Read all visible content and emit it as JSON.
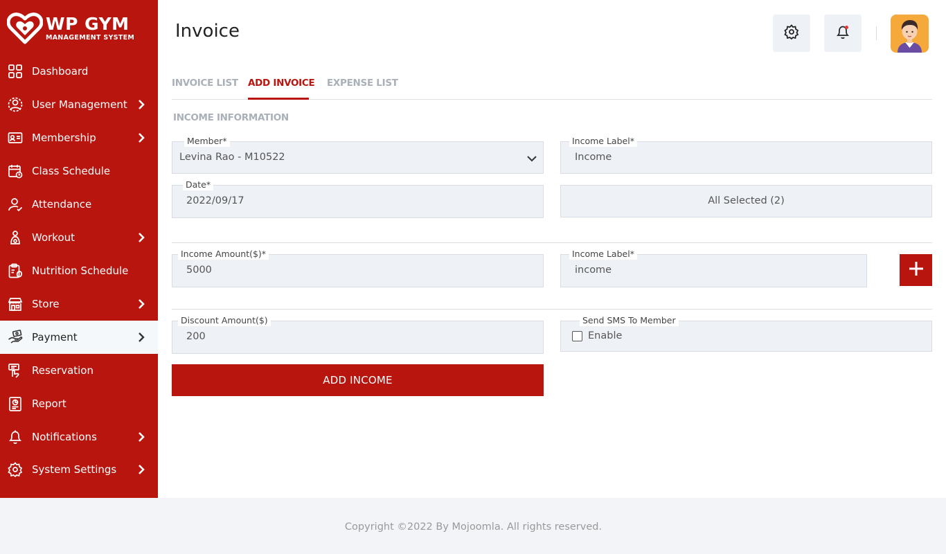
{
  "brand": {
    "title": "WP GYM",
    "subtitle": "MANAGEMENT SYSTEM"
  },
  "sidebar": {
    "items": [
      {
        "label": "Dashboard",
        "icon": "dashboard-grid-icon",
        "has_submenu": false
      },
      {
        "label": "User Management",
        "icon": "users-icon",
        "has_submenu": true
      },
      {
        "label": "Membership",
        "icon": "membership-card-icon",
        "has_submenu": true
      },
      {
        "label": "Class Schedule",
        "icon": "calendar-icon",
        "has_submenu": false
      },
      {
        "label": "Attendance",
        "icon": "user-check-icon",
        "has_submenu": false
      },
      {
        "label": "Workout",
        "icon": "workout-icon",
        "has_submenu": true
      },
      {
        "label": "Nutrition Schedule",
        "icon": "nutrition-clipboard-icon",
        "has_submenu": false
      },
      {
        "label": "Store",
        "icon": "store-icon",
        "has_submenu": true
      },
      {
        "label": "Payment",
        "icon": "payment-hand-icon",
        "has_submenu": true,
        "active": true
      },
      {
        "label": "Reservation",
        "icon": "reservation-icon",
        "has_submenu": false
      },
      {
        "label": "Report",
        "icon": "report-icon",
        "has_submenu": false
      },
      {
        "label": "Notifications",
        "icon": "bell-icon",
        "has_submenu": true
      },
      {
        "label": "System Settings",
        "icon": "gear-icon",
        "has_submenu": true
      }
    ]
  },
  "header": {
    "title": "Invoice"
  },
  "tabs": [
    {
      "label": "INVOICE LIST"
    },
    {
      "label": "ADD INVOICE",
      "active": true
    },
    {
      "label": "EXPENSE LIST"
    }
  ],
  "form": {
    "section_title": "INCOME INFORMATION",
    "member": {
      "label": "Member*",
      "value": "Levina Rao - M10522"
    },
    "income_label_1": {
      "label": "Income Label*",
      "value": "Income"
    },
    "date": {
      "label": "Date*",
      "value": "2022/09/17"
    },
    "tax_select": {
      "value": "All Selected (2)"
    },
    "income_amount": {
      "label": "Income Amount($)*",
      "value": "5000"
    },
    "income_label_2": {
      "label": "Income Label*",
      "value": "income"
    },
    "discount_amount": {
      "label": "Discount Amount($)",
      "value": "200"
    },
    "send_sms": {
      "label": "Send SMS To Member",
      "option": "Enable",
      "checked": false
    },
    "submit_label": "ADD INCOME"
  },
  "footer": {
    "text": "Copyright ©2022 By Mojoomla. All rights reserved."
  },
  "colors": {
    "brand_red": "#b8150f",
    "field_bg": "#eef1f6",
    "sidebar_active_bg": "#f5f8fb"
  }
}
